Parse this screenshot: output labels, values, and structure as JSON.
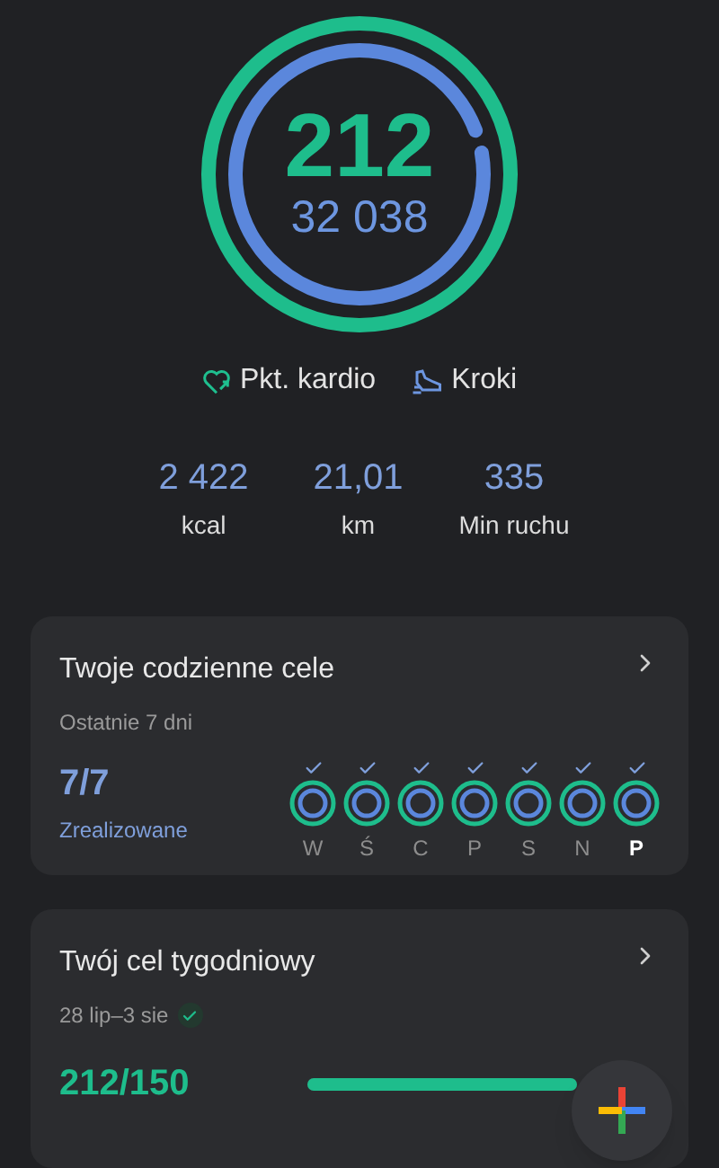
{
  "rings": {
    "outer": {
      "level": 1
    },
    "inner": {
      "level": 0.97
    }
  },
  "primary_value": "212",
  "secondary_value": "32 038",
  "legend": [
    {
      "kind": "heart",
      "label": "Pkt. kardio"
    },
    {
      "kind": "shoe",
      "label": "Kroki"
    }
  ],
  "stats": [
    {
      "value": "2 422",
      "label": "kcal"
    },
    {
      "value": "21,01",
      "label": "km"
    },
    {
      "value": "335",
      "label": "Min ruchu"
    }
  ],
  "daily_goals": {
    "title": "Twoje codzienne cele",
    "subtitle": "Ostatnie 7 dni",
    "count": "7/7",
    "status": "Zrealizowane",
    "days": [
      {
        "label": "W",
        "checked": true,
        "selected": false
      },
      {
        "label": "Ś",
        "checked": true,
        "selected": false
      },
      {
        "label": "C",
        "checked": true,
        "selected": false
      },
      {
        "label": "P",
        "checked": true,
        "selected": false
      },
      {
        "label": "S",
        "checked": true,
        "selected": false
      },
      {
        "label": "N",
        "checked": true,
        "selected": false
      },
      {
        "label": "P",
        "checked": true,
        "selected": true
      }
    ]
  },
  "weekly_goal": {
    "title": "Twój cel tygodniowy",
    "range": "28 lip–3 sie",
    "achieved": true,
    "count": "212/150",
    "level": 1
  }
}
